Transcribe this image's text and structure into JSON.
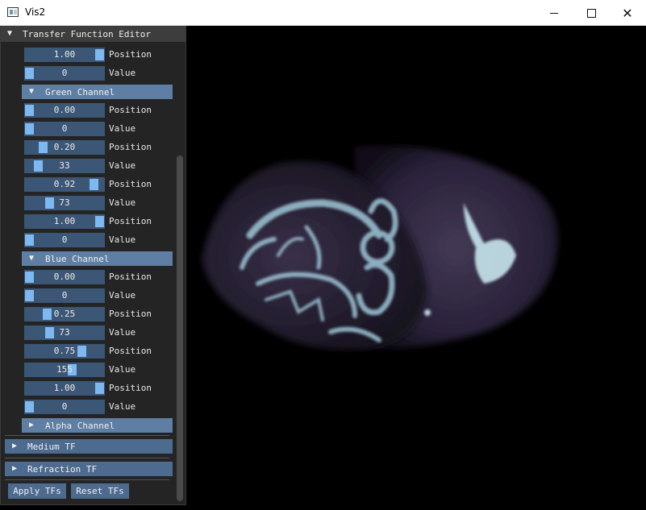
{
  "window": {
    "title": "Vis2",
    "minimize_icon": "minimize-icon",
    "maximize_icon": "maximize-icon",
    "close_icon": "close-icon"
  },
  "panel": {
    "title": "Transfer Function Editor",
    "top_rows": [
      {
        "value": "1.00",
        "label": "Position",
        "fraction": 1.0
      },
      {
        "value": "0",
        "label": "Value",
        "fraction": 0.0
      }
    ],
    "green": {
      "label": "Green Channel",
      "rows": [
        {
          "value": "0.00",
          "label": "Position",
          "fraction": 0.0
        },
        {
          "value": "0",
          "label": "Value",
          "fraction": 0.0
        },
        {
          "value": "0.20",
          "label": "Position",
          "fraction": 0.2
        },
        {
          "value": "33",
          "label": "Value",
          "fraction": 0.13
        },
        {
          "value": "0.92",
          "label": "Position",
          "fraction": 0.92
        },
        {
          "value": "73",
          "label": "Value",
          "fraction": 0.29
        },
        {
          "value": "1.00",
          "label": "Position",
          "fraction": 1.0
        },
        {
          "value": "0",
          "label": "Value",
          "fraction": 0.0
        }
      ]
    },
    "blue": {
      "label": "Blue Channel",
      "rows": [
        {
          "value": "0.00",
          "label": "Position",
          "fraction": 0.0
        },
        {
          "value": "0",
          "label": "Value",
          "fraction": 0.0
        },
        {
          "value": "0.25",
          "label": "Position",
          "fraction": 0.25
        },
        {
          "value": "73",
          "label": "Value",
          "fraction": 0.29
        },
        {
          "value": "0.75",
          "label": "Position",
          "fraction": 0.75
        },
        {
          "value": "155",
          "label": "Value",
          "fraction": 0.61
        },
        {
          "value": "1.00",
          "label": "Position",
          "fraction": 1.0
        },
        {
          "value": "0",
          "label": "Value",
          "fraction": 0.0
        }
      ]
    },
    "alpha": {
      "label": "Alpha Channel"
    },
    "medium": {
      "label": "Medium TF"
    },
    "refraction": {
      "label": "Refraction TF"
    },
    "apply_label": "Apply TFs",
    "reset_label": "Reset TFs"
  },
  "colors": {
    "slider_bg": "#3c5676",
    "grab": "#7db8f0",
    "header": "#5e7ea3",
    "panel_bg": "#242424"
  }
}
